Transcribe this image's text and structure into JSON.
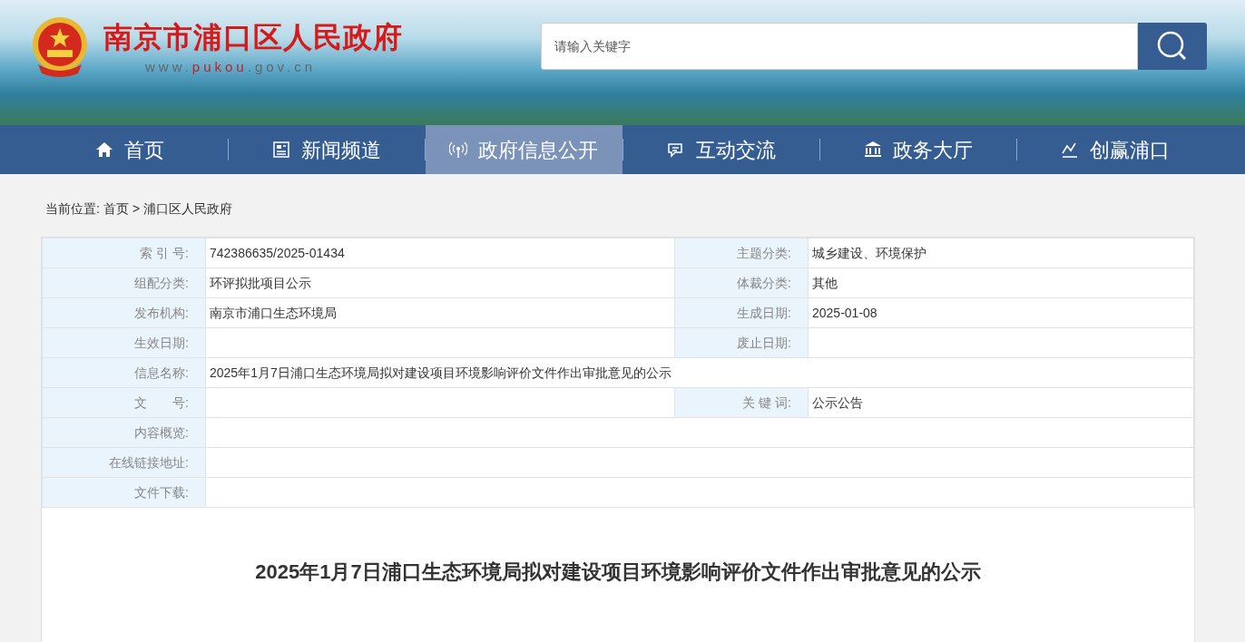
{
  "header": {
    "site_title": "南京市浦口区人民政府",
    "site_url_prefix": "www.",
    "site_url_highlight": "pukou",
    "site_url_suffix": ".gov.cn"
  },
  "search": {
    "placeholder": "请输入关键字"
  },
  "nav": [
    {
      "label": "首页",
      "selected": false
    },
    {
      "label": "新闻频道",
      "selected": false
    },
    {
      "label": "政府信息公开",
      "selected": true
    },
    {
      "label": "互动交流",
      "selected": false
    },
    {
      "label": "政务大厅",
      "selected": false
    },
    {
      "label": "创赢浦口",
      "selected": false
    }
  ],
  "breadcrumb": {
    "label": "当前位置:",
    "items": [
      "首页",
      "浦口区人民政府"
    ],
    "separator": ">"
  },
  "info_table": [
    {
      "cells": [
        {
          "label": "索 引 号:",
          "value": "742386635/2025-01434"
        },
        {
          "label": "主题分类:",
          "value": "城乡建设、环境保护"
        }
      ]
    },
    {
      "cells": [
        {
          "label": "组配分类:",
          "value": "环评拟批项目公示"
        },
        {
          "label": "体裁分类:",
          "value": "其他"
        }
      ]
    },
    {
      "cells": [
        {
          "label": "发布机构:",
          "value": "南京市浦口生态环境局"
        },
        {
          "label": "生成日期:",
          "value": "2025-01-08"
        }
      ]
    },
    {
      "cells": [
        {
          "label": "生效日期:"
        },
        {
          "label": "废止日期:"
        }
      ]
    },
    {
      "cells": [
        {
          "label": "信息名称:",
          "value": "2025年1月7日浦口生态环境局拟对建设项目环境影响评价文件作出审批意见的公示"
        }
      ]
    },
    {
      "cells": [
        {
          "label": "文　　号:"
        },
        {
          "label": "关 键 词:",
          "value": "公示公告"
        }
      ]
    },
    {
      "cells": [
        {
          "label": "内容概览:"
        }
      ]
    },
    {
      "cells": [
        {
          "label": "在线链接地址:"
        }
      ]
    },
    {
      "cells": [
        {
          "label": "文件下载:"
        }
      ]
    }
  ],
  "article": {
    "title": "2025年1月7日浦口生态环境局拟对建设项目环境影响评价文件作出审批意见的公示"
  }
}
